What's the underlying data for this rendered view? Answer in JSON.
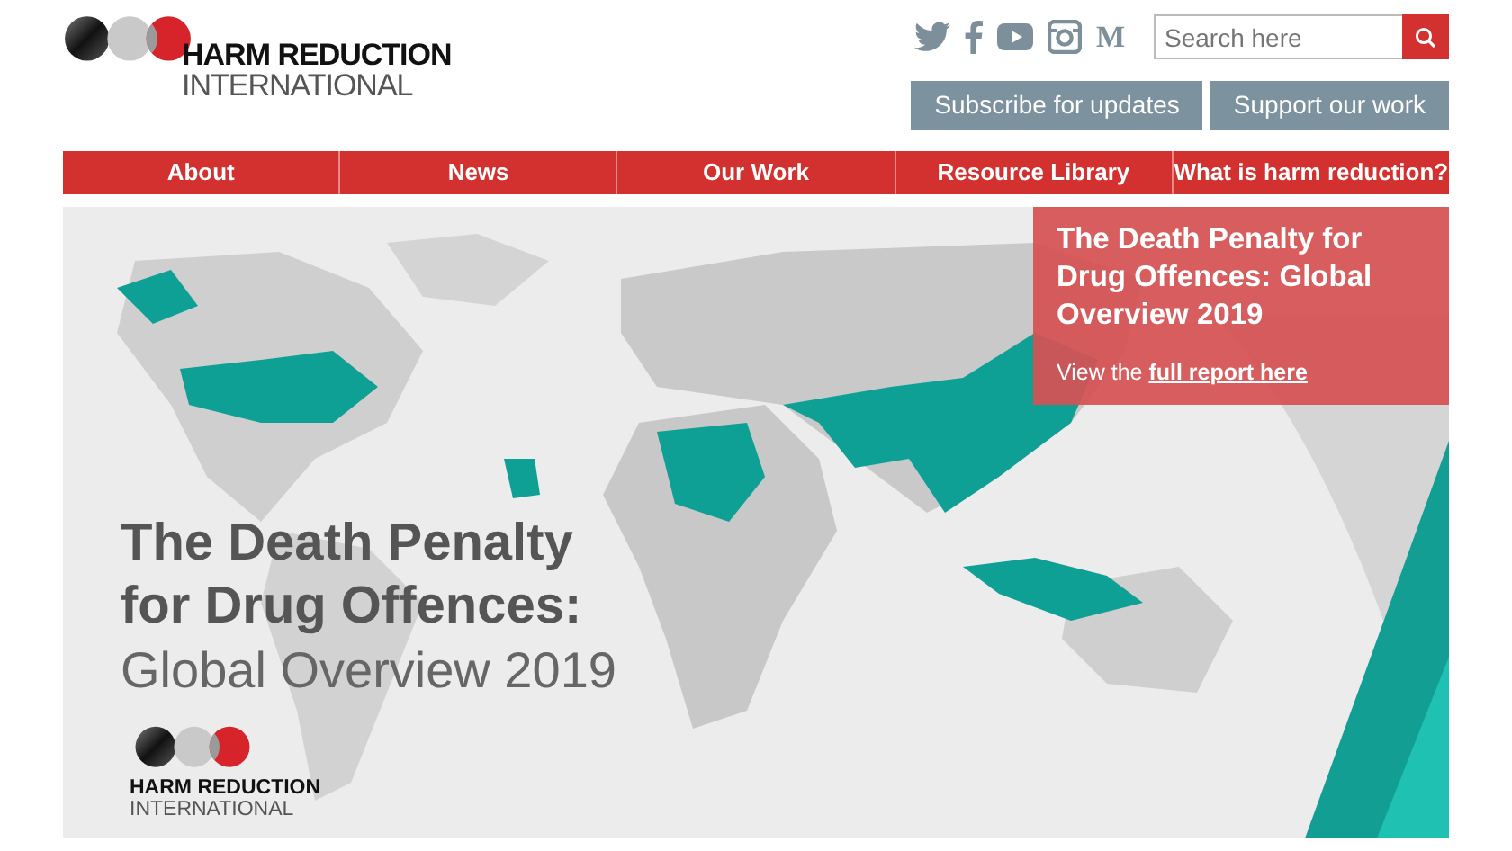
{
  "logo": {
    "line1": "HARM REDUCTION",
    "line2": "INTERNATIONAL"
  },
  "social": [
    {
      "kind": "twitter"
    },
    {
      "kind": "facebook"
    },
    {
      "kind": "youtube"
    },
    {
      "kind": "instagram"
    },
    {
      "kind": "letter",
      "label": "M"
    }
  ],
  "search": {
    "placeholder": "Search here"
  },
  "header_buttons": [
    "Subscribe for updates",
    "Support our work"
  ],
  "nav": [
    {
      "label": "About"
    },
    {
      "label": "News"
    },
    {
      "label": "Our Work"
    },
    {
      "label": "Resource Library"
    },
    {
      "label": "What is harm reduction?"
    }
  ],
  "banner": {
    "kind": "picture",
    "heading": [
      "The Death Penalty",
      "for Drug Offences:"
    ],
    "subheading": "Global Overview 2019",
    "logo": {
      "line1": "HARM REDUCTION",
      "line2": "INTERNATIONAL"
    },
    "callout": {
      "title": "The Death Penalty for Drug Offences: Global Overview 2019",
      "text": "View the",
      "link": "full report here"
    }
  }
}
